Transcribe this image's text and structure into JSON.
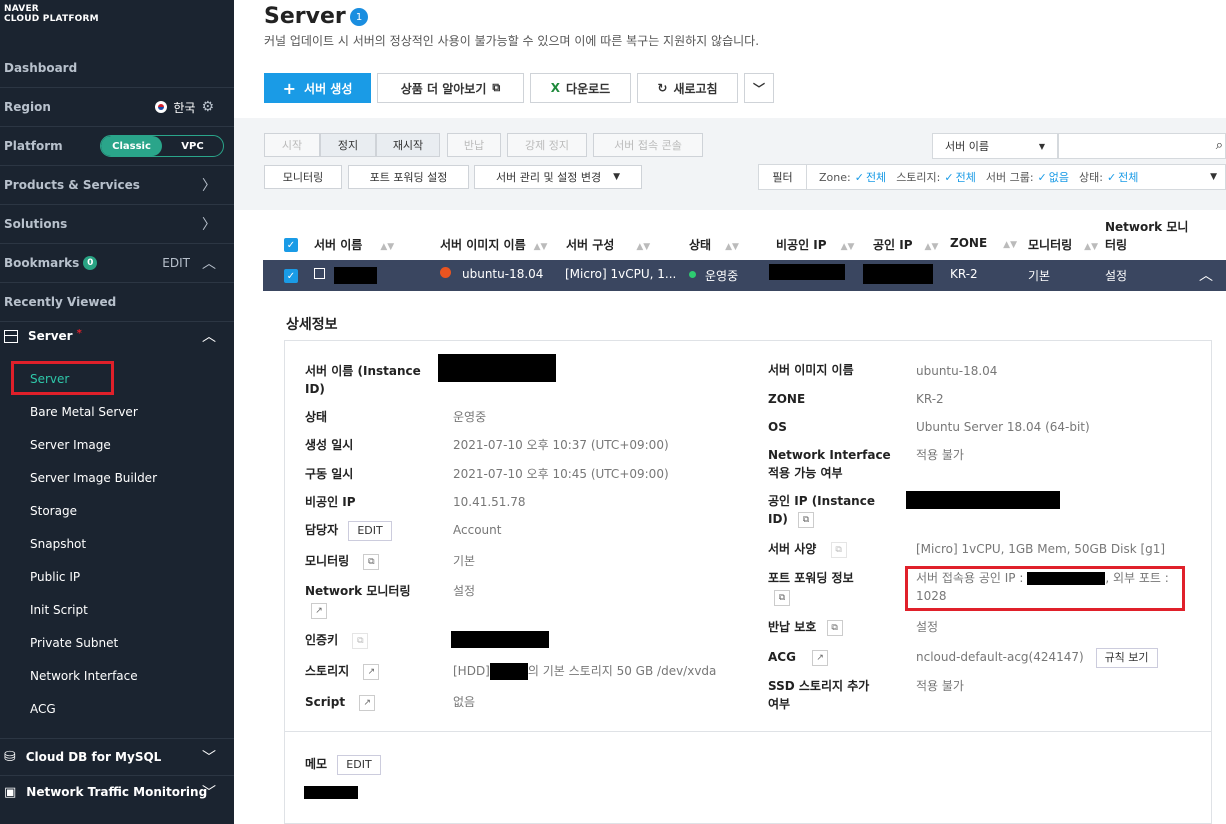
{
  "logo": {
    "line1": "NAVER",
    "line2": "CLOUD PLATFORM"
  },
  "sidebar": {
    "dashboard": "Dashboard",
    "region": {
      "label": "Region",
      "value": "한국"
    },
    "platform": {
      "label": "Platform",
      "options": [
        "Classic",
        "VPC"
      ],
      "active": "Classic"
    },
    "products": "Products & Services",
    "solutions": "Solutions",
    "bookmarks": {
      "label": "Bookmarks",
      "count": "0",
      "edit": "EDIT"
    },
    "recently_viewed": "Recently Viewed",
    "server_group": {
      "label": "Server",
      "mark": "*"
    },
    "server_items": [
      "Server",
      "Bare Metal Server",
      "Server Image",
      "Server Image Builder",
      "Storage",
      "Snapshot",
      "Public IP",
      "Init Script",
      "Private Subnet",
      "Network Interface",
      "ACG"
    ],
    "cloud_db": "Cloud DB for MySQL",
    "ntm": "Network Traffic Monitoring"
  },
  "header": {
    "title": "Server",
    "badge": "1",
    "subtitle": "커널 업데이트 시 서버의 정상적인 사용이 불가능할 수 있으며 이에 따른 복구는 지원하지 않습니다."
  },
  "actions": {
    "create": "서버 생성",
    "learn": "상품 더 알아보기",
    "download": "다운로드",
    "refresh": "새로고침"
  },
  "toolbar": {
    "row1": [
      "시작",
      "정지",
      "재시작",
      "반납",
      "강제 정지",
      "서버 접속 콘솔"
    ],
    "row2": [
      "모니터링",
      "포트 포워딩 설정",
      "서버 관리 및 설정 변경"
    ],
    "search_select": "서버 이름",
    "filter": {
      "label": "필터",
      "zone_label": "Zone:",
      "zone_val": "전체",
      "storage_label": "스토리지:",
      "storage_val": "전체",
      "group_label": "서버 그룹:",
      "group_val": "없음",
      "status_label": "상태:",
      "status_val": "전체"
    }
  },
  "table": {
    "headers": [
      "서버 이름",
      "서버 이미지 이름",
      "서버 구성",
      "상태",
      "비공인 IP",
      "공인 IP",
      "ZONE",
      "모니터링"
    ],
    "header_net_line1": "Network 모니",
    "header_net_line2": "터링",
    "row": {
      "image": "ubuntu-18.04",
      "spec": "[Micro] 1vCPU, 1...",
      "status": "운영중",
      "zone": "KR-2",
      "monitoring": "기본",
      "network": "설정"
    }
  },
  "details": {
    "title": "상세정보",
    "left": {
      "name_label_1": "서버 이름 (Instance",
      "name_label_2": "ID)",
      "status_label": "상태",
      "status_value": "운영중",
      "created_label": "생성 일시",
      "created_value": "2021-07-10 오후 10:37 (UTC+09:00)",
      "started_label": "구동 일시",
      "started_value": "2021-07-10 오후 10:45 (UTC+09:00)",
      "private_ip_label": "비공인 IP",
      "private_ip_value": "10.41.51.78",
      "owner_label": "담당자",
      "owner_edit": "EDIT",
      "owner_value": "Account",
      "monitoring_label": "모니터링",
      "monitoring_value": "기본",
      "net_mon_label": "Network 모니터링",
      "net_mon_value": "설정",
      "auth_key_label": "인증키",
      "storage_label": "스토리지",
      "storage_prefix": "[HDD]",
      "storage_suffix": "의 기본 스토리지  50 GB /dev/xvda",
      "script_label": "Script",
      "script_value": "없음"
    },
    "right": {
      "image_label": "서버 이미지 이름",
      "image_value": "ubuntu-18.04",
      "zone_label": "ZONE",
      "zone_value": "KR-2",
      "os_label": "OS",
      "os_value": "Ubuntu Server 18.04 (64-bit)",
      "ni_label_1": "Network Interface",
      "ni_label_2": "적용 가능 여부",
      "ni_value": "적용 불가",
      "public_ip_label_1": "공인 IP (Instance",
      "public_ip_label_2": "ID)",
      "spec_label": "서버 사양",
      "spec_value": "[Micro] 1vCPU, 1GB Mem, 50GB Disk [g1]",
      "pf_label": "포트 포워딩 정보",
      "pf_value_1": "서버 접속용 공인 IP :",
      "pf_value_2": ", 외부 포트 :",
      "pf_value_3": "1028",
      "return_label": "반납 보호",
      "return_value": "설정",
      "acg_label": "ACG",
      "acg_value": "ncloud-default-acg(424147)",
      "acg_btn": "규칙 보기",
      "ssd_label_1": "SSD 스토리지 추가",
      "ssd_label_2": "여부",
      "ssd_value": "적용 불가"
    },
    "memo_label": "메모",
    "memo_edit": "EDIT"
  }
}
